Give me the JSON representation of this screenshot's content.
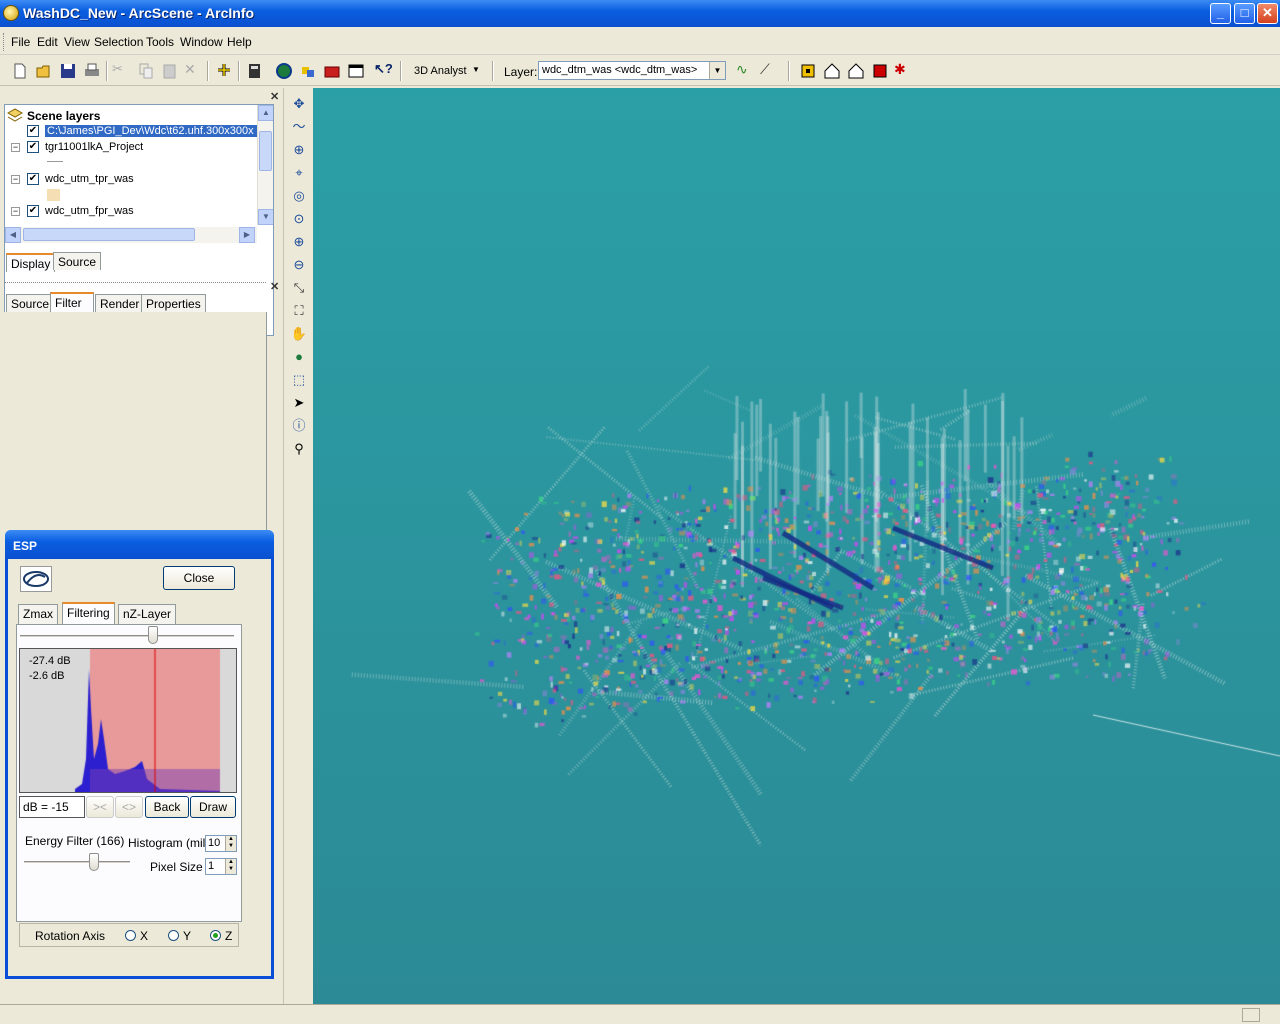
{
  "window": {
    "title": "WashDC_New - ArcScene - ArcInfo"
  },
  "menu": [
    "File",
    "Edit",
    "View",
    "Selection",
    "Tools",
    "Window",
    "Help"
  ],
  "toolbar": {
    "analyst_label": "3D Analyst",
    "layer_label": "Layer:",
    "layer_value": "wdc_dtm_was <wdc_dtm_was>"
  },
  "toc": {
    "header": "Scene layers",
    "rows": [
      {
        "label": "C:\\James\\PGI_Dev\\Wdc\\t62.uhf.300x300x"
      },
      {
        "label": "tgr11001lkA_Project"
      },
      {
        "label": "wdc_utm_tpr_was"
      },
      {
        "label": "wdc_utm_fpr_was"
      }
    ],
    "tabs": [
      "Display",
      "Source"
    ]
  },
  "props_tabs": [
    "Source",
    "Filter",
    "Render",
    "Properties"
  ],
  "esp": {
    "title": "ESP",
    "close_label": "Close",
    "tabs": [
      "Zmax",
      "Filtering",
      "nZ-Layer"
    ],
    "filter_slider_level": 0.62,
    "hist_label_1": "-27.4 dB",
    "hist_label_2": "-2.6 dB",
    "db_value": "dB = -15",
    "prev_label": "><",
    "next_label": "<>",
    "back_label": "Back",
    "draw_label": "Draw",
    "energy_label": "Energy Filter (166)",
    "energy_level": 0.66,
    "histogram_label": "Histogram (mil)",
    "histogram_value": "10",
    "pixel_label": "Pixel Size",
    "pixel_value": "1",
    "rotation_label": "Rotation Axis",
    "axis_x": "X",
    "axis_y": "Y",
    "axis_z": "Z",
    "selected_axis": "Z"
  }
}
